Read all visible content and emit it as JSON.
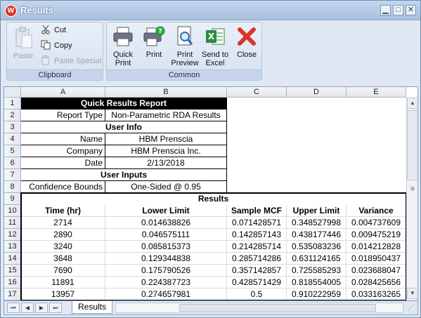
{
  "window": {
    "title": "Results"
  },
  "ribbon": {
    "clipboard": {
      "label": "Clipboard",
      "paste": "Paste",
      "cut": "Cut",
      "copy": "Copy",
      "paste_special": "Paste Special"
    },
    "common": {
      "label": "Common",
      "quick_print": [
        "Quick",
        "Print"
      ],
      "print": "Print",
      "print_preview": [
        "Print",
        "Preview"
      ],
      "send_to_excel": [
        "Send to",
        "Excel"
      ],
      "close": "Close"
    }
  },
  "sheet": {
    "columns": [
      "A",
      "B",
      "C",
      "D",
      "E"
    ],
    "rows": [
      "1",
      "2",
      "3",
      "4",
      "5",
      "6",
      "7",
      "8",
      "9",
      "10",
      "11",
      "12",
      "13",
      "14",
      "15",
      "16",
      "17"
    ],
    "report_title": "Quick Results Report",
    "report_type_label": "Report Type",
    "report_type_value": "Non-Parametric RDA Results",
    "user_info": "User Info",
    "name_label": "Name",
    "name_value": "HBM Prenscia",
    "company_label": "Company",
    "company_value": "HBM Prenscia Inc.",
    "date_label": "Date",
    "date_value": "2/13/2018",
    "user_inputs": "User Inputs",
    "confidence_label": "Confidence Bounds",
    "confidence_value": "One-Sided @ 0.95",
    "results_title": "Results",
    "results_headers": [
      "Time (hr)",
      "Lower Limit",
      "Sample MCF",
      "Upper Limit",
      "Variance"
    ],
    "results_rows": [
      [
        "2714",
        "0.014638826",
        "0.071428571",
        "0.348527998",
        "0.004737609"
      ],
      [
        "2890",
        "0.046575111",
        "0.142857143",
        "0.438177446",
        "0.009475219"
      ],
      [
        "3240",
        "0.085815373",
        "0.214285714",
        "0.535083236",
        "0.014212828"
      ],
      [
        "3648",
        "0.129344838",
        "0.285714286",
        "0.631124165",
        "0.018950437"
      ],
      [
        "7690",
        "0.175790526",
        "0.357142857",
        "0.725585293",
        "0.023688047"
      ],
      [
        "11891",
        "0.224387723",
        "0.428571429",
        "0.818554005",
        "0.028425656"
      ],
      [
        "13957",
        "0.274657981",
        "0.5",
        "0.910222959",
        "0.033163265"
      ]
    ]
  },
  "footer": {
    "sheet_tab": "Results"
  },
  "colors": {
    "header_bg": "#000000",
    "title_bar": "#a9c1df",
    "close_icon": "#d9352b",
    "excel_icon": "#2d8a3e",
    "print_badge": "#2fae3c"
  }
}
